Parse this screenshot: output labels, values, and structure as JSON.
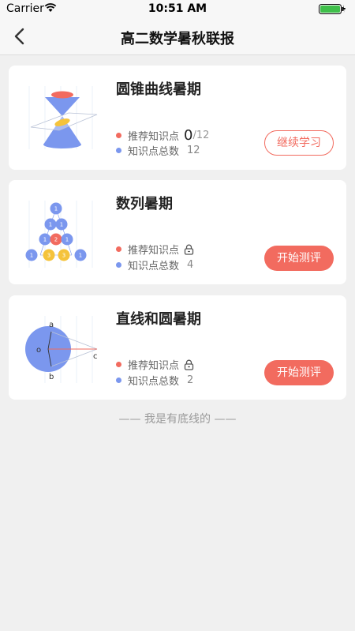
{
  "status_bar": {
    "carrier": "Carrier",
    "time": "10:51 AM"
  },
  "nav": {
    "title": "高二数学暑秋联报"
  },
  "courses": [
    {
      "title": "圆锥曲线暑期",
      "recommend_label": "推荐知识点",
      "recommend_done": "0",
      "recommend_total": "/12",
      "total_label": "知识点总数",
      "total_count": "12",
      "button": "继续学习"
    },
    {
      "title": "数列暑期",
      "recommend_label": "推荐知识点",
      "total_label": "知识点总数",
      "total_count": "4",
      "button": "开始测评",
      "triangle_numbers": [
        "1",
        "1",
        "1",
        "1",
        "2",
        "1",
        "1",
        "3",
        "3",
        "1"
      ]
    },
    {
      "title": "直线和圆暑期",
      "recommend_label": "推荐知识点",
      "total_label": "知识点总数",
      "total_count": "2",
      "button": "开始测评",
      "point_labels": {
        "a": "a",
        "o": "o",
        "b": "b",
        "c": "c"
      }
    }
  ],
  "footer": "—— 我是有底线的 ——",
  "colors": {
    "accent": "#f26b5f",
    "blue": "#7b97ee",
    "yellow": "#f5c33b"
  }
}
